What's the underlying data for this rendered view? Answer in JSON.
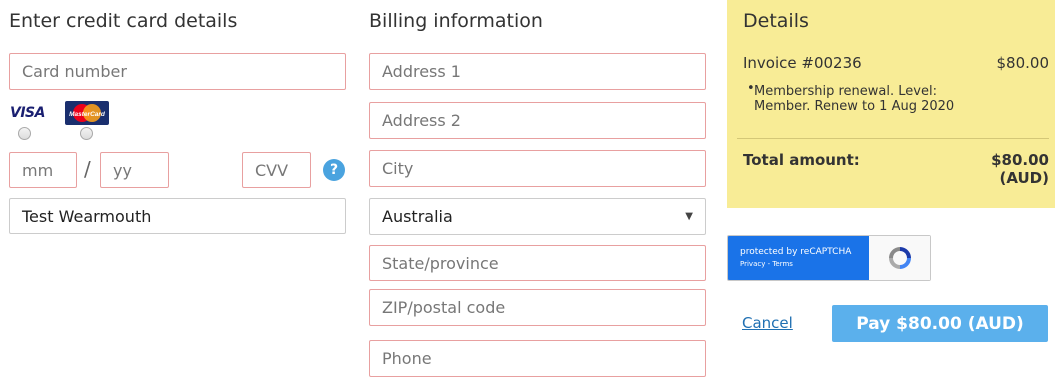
{
  "card_section": {
    "heading": "Enter credit card details",
    "card_number_placeholder": "Card number",
    "brands": [
      {
        "name": "VISA",
        "color": "#1a1f71"
      },
      {
        "name": "MasterCard",
        "color": "#eb001b"
      }
    ],
    "month_placeholder": "mm",
    "separator": "/",
    "year_placeholder": "yy",
    "cvv_placeholder": "CVV",
    "help_icon": "?",
    "cardholder_name": "Test Wearmouth"
  },
  "billing": {
    "heading": "Billing information",
    "address1_placeholder": "Address 1",
    "address2_placeholder": "Address 2",
    "city_placeholder": "City",
    "country_value": "Australia",
    "state_placeholder": "State/province",
    "zip_placeholder": "ZIP/postal code",
    "phone_placeholder": "Phone"
  },
  "details": {
    "heading": "Details",
    "invoice_label": "Invoice #00236",
    "invoice_amount": "$80.00",
    "item_description": "Membership renewal. Level: Member. Renew to 1 Aug 2020",
    "total_label": "Total amount:",
    "total_amount_line1": "$80.00",
    "total_amount_line2": "(AUD)",
    "panel_color": "#f8ec96"
  },
  "recaptcha": {
    "line1": "protected by reCAPTCHA",
    "line2": "Privacy - Terms"
  },
  "actions": {
    "cancel_label": "Cancel",
    "pay_label": "Pay $80.00 (AUD)",
    "pay_color": "#5bb0ec"
  }
}
